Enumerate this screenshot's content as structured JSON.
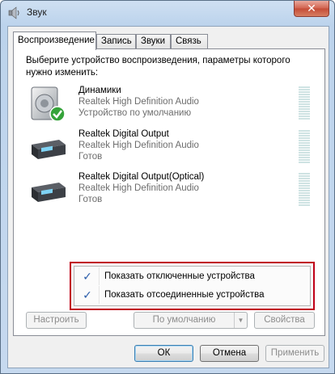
{
  "window": {
    "title": "Звук",
    "close_glyph": "✕"
  },
  "tabs": [
    {
      "label": "Воспроизведение",
      "active": true
    },
    {
      "label": "Запись",
      "active": false
    },
    {
      "label": "Звуки",
      "active": false
    },
    {
      "label": "Связь",
      "active": false
    }
  ],
  "panel": {
    "instructions": "Выберите устройство воспроизведения, параметры которого нужно изменить:"
  },
  "devices": [
    {
      "name": "Динамики",
      "driver": "Realtek High Definition Audio",
      "status": "Устройство по умолчанию",
      "icon": "speaker-icon",
      "is_default": true
    },
    {
      "name": "Realtek Digital Output",
      "driver": "Realtek High Definition Audio",
      "status": "Готов",
      "icon": "digital-output-icon",
      "is_default": false
    },
    {
      "name": "Realtek Digital Output(Optical)",
      "driver": "Realtek High Definition Audio",
      "status": "Готов",
      "icon": "digital-output-icon",
      "is_default": false
    }
  ],
  "context_menu": {
    "items": [
      {
        "label": "Показать отключенные устройства",
        "checked": true
      },
      {
        "label": "Показать отсоединенные устройства",
        "checked": true
      }
    ],
    "check_glyph": "✓",
    "highlight_color": "#c00018"
  },
  "buttons": {
    "configure": "Настроить",
    "set_default": "По умолчанию",
    "properties": "Свойства",
    "ok": "ОК",
    "cancel": "Отмена",
    "apply": "Применить"
  }
}
